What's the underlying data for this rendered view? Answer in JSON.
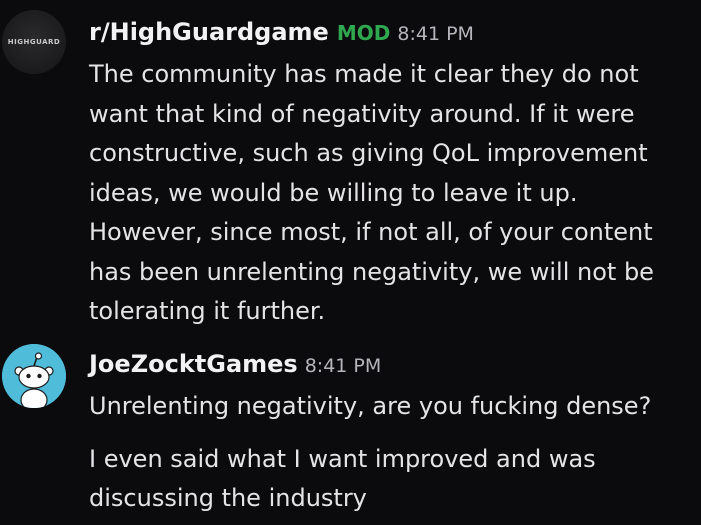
{
  "messages": [
    {
      "username": "r/HighGuardgame",
      "badge": "MOD",
      "time": "8:41 PM",
      "avatar_text": "HIGHGUARD",
      "avatar_icon": "highguard-logo-icon",
      "lines": [
        "The community has made it clear they do not",
        "want that kind of negativity around. If it were",
        "constructive, such as giving QoL improvement",
        "ideas, we would be willing to leave it up.",
        "However, since most, if not all, of your content",
        "has been unrelenting negativity, we will not be",
        "tolerating it further."
      ]
    },
    {
      "username": "JoeZocktGames",
      "time": "8:41 PM",
      "avatar_icon": "reddit-snoo-icon",
      "paragraphs": [
        [
          "Unrelenting negativity, are you fucking dense?"
        ],
        [
          "I even said what I want improved and was",
          "discussing the industry"
        ]
      ]
    }
  ],
  "colors": {
    "background": "#0b0b0d",
    "mod_badge": "#2fa84f",
    "snoo_bg": "#4fbcd9"
  }
}
